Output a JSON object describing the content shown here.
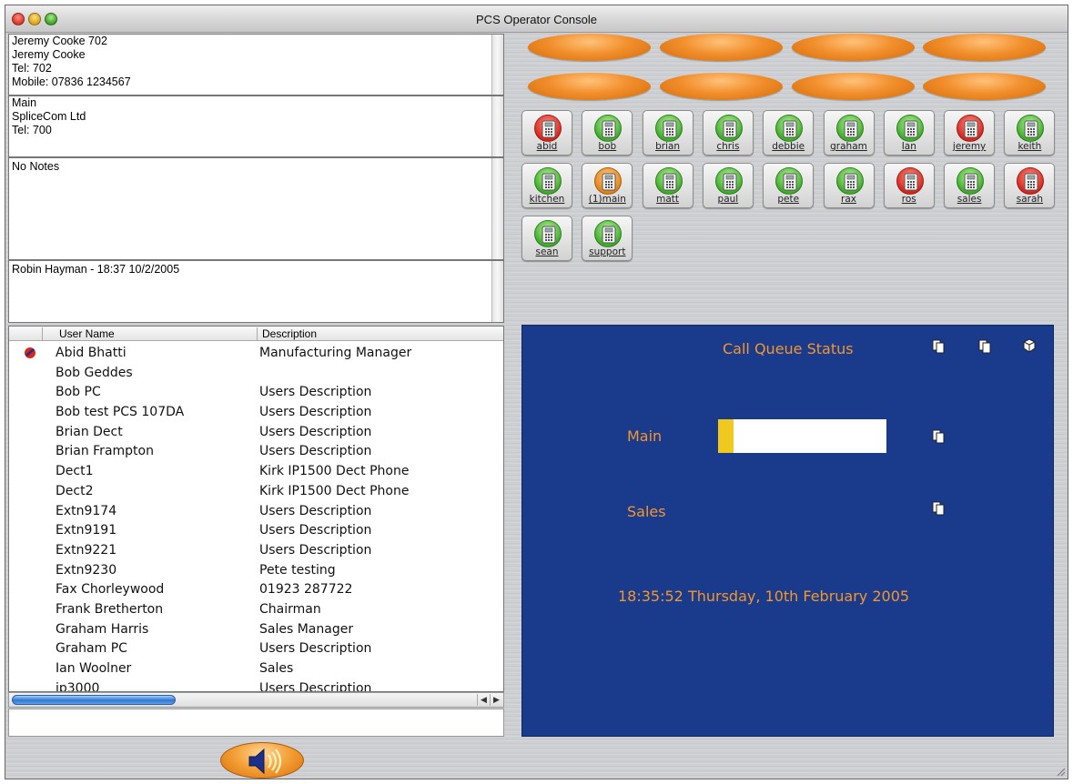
{
  "window": {
    "title": "PCS Operator Console"
  },
  "contact": {
    "lines": [
      "Jeremy Cooke 702",
      "Jeremy Cooke",
      "Tel: 702",
      "Mobile: 07836 1234567"
    ]
  },
  "company": {
    "lines": [
      "Main",
      "SpliceCom Ltd",
      "Tel: 700"
    ]
  },
  "notes": {
    "text": "No Notes"
  },
  "history": {
    "text": "Robin Hayman - 18:37 10/2/2005"
  },
  "user_table": {
    "columns": [
      "User Name",
      "Description"
    ],
    "rows": [
      {
        "name": "Abid Bhatti",
        "description": "Manufacturing Manager",
        "status": "busy"
      },
      {
        "name": "Bob Geddes",
        "description": ""
      },
      {
        "name": "Bob PC",
        "description": "Users Description"
      },
      {
        "name": "Bob test PCS 107DA",
        "description": "Users Description"
      },
      {
        "name": "Brian Dect",
        "description": "Users Description"
      },
      {
        "name": "Brian Frampton",
        "description": "Users Description"
      },
      {
        "name": "Dect1",
        "description": "Kirk IP1500 Dect Phone"
      },
      {
        "name": "Dect2",
        "description": "Kirk IP1500 Dect Phone"
      },
      {
        "name": "Extn9174",
        "description": "Users Description"
      },
      {
        "name": "Extn9191",
        "description": "Users Description"
      },
      {
        "name": "Extn9221",
        "description": "Users Description"
      },
      {
        "name": "Extn9230",
        "description": "Pete testing"
      },
      {
        "name": "Fax Chorleywood",
        "description": "01923 287722"
      },
      {
        "name": "Frank Bretherton",
        "description": "Chairman"
      },
      {
        "name": "Graham Harris",
        "description": "Sales Manager"
      },
      {
        "name": "Graham PC",
        "description": "Users Description"
      },
      {
        "name": "Ian Woolner",
        "description": "Sales"
      },
      {
        "name": "ip3000",
        "description": "Users Description"
      }
    ]
  },
  "extensions": [
    {
      "label": "abid",
      "status": "red"
    },
    {
      "label": "bob",
      "status": "green"
    },
    {
      "label": "brian",
      "status": "green"
    },
    {
      "label": "chris",
      "status": "green"
    },
    {
      "label": "debbie",
      "status": "green"
    },
    {
      "label": "graham",
      "status": "green"
    },
    {
      "label": "Ian",
      "status": "green"
    },
    {
      "label": "jeremy",
      "status": "red"
    },
    {
      "label": "keith",
      "status": "green"
    },
    {
      "label": "kitchen",
      "status": "green"
    },
    {
      "label": "(1)main",
      "status": "orange"
    },
    {
      "label": "matt",
      "status": "green"
    },
    {
      "label": "paul",
      "status": "green"
    },
    {
      "label": "pete",
      "status": "green"
    },
    {
      "label": "rax",
      "status": "green"
    },
    {
      "label": "ros",
      "status": "red"
    },
    {
      "label": "sales",
      "status": "green"
    },
    {
      "label": "sarah",
      "status": "red"
    },
    {
      "label": "sean",
      "status": "green"
    },
    {
      "label": "support",
      "status": "green"
    }
  ],
  "queue": {
    "title": "Call Queue Status",
    "queues": [
      {
        "name": "Main",
        "fill_fraction": 0.09
      },
      {
        "name": "Sales"
      }
    ],
    "clock": "18:35:52 Thursday, 10th February 2005"
  },
  "colors": {
    "accent_orange": "#f2962e",
    "panel_blue": "#1a3a8c",
    "queue_fill": "#f0c81e"
  }
}
